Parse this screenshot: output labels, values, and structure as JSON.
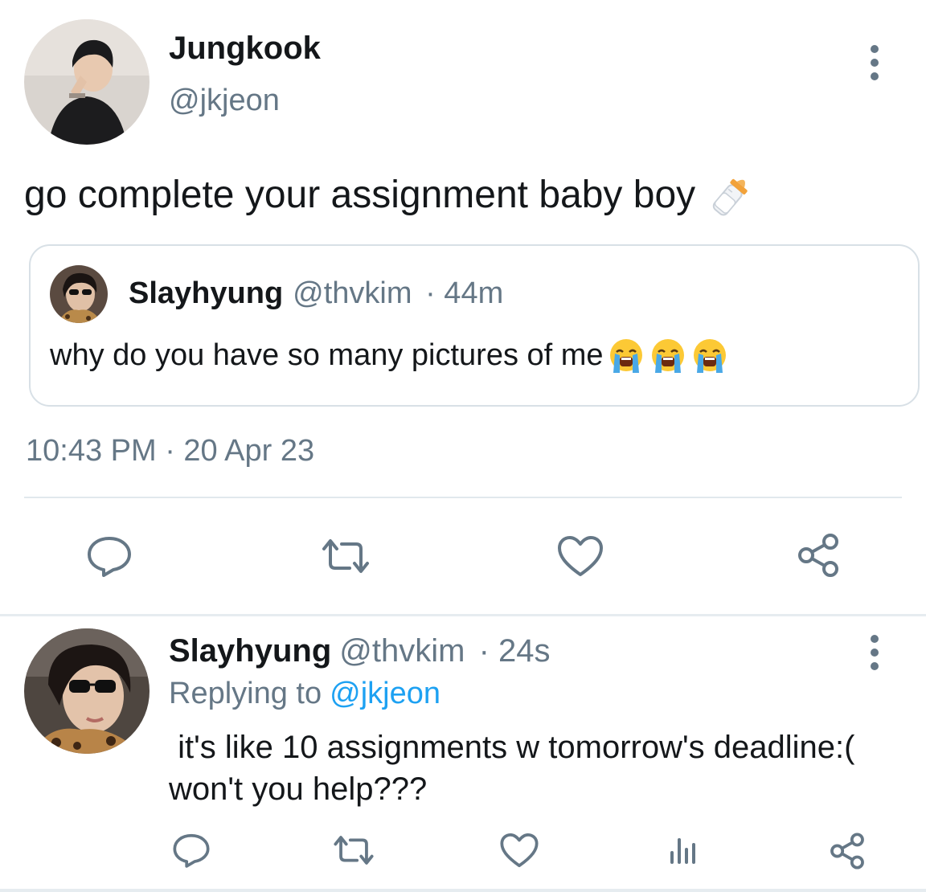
{
  "main_tweet": {
    "display_name": "Jungkook",
    "handle": "@jkjeon",
    "text": "go complete your assignment baby boy",
    "emoji": "baby-bottle-icon",
    "timestamp": "10:43 PM · 20 Apr 23"
  },
  "quoted_tweet": {
    "display_name": "Slayhyung",
    "handle": "@thvkim",
    "time": "· 44m",
    "text": "why do you have so many pictures of me",
    "emoji": [
      "crying-face-icon",
      "crying-face-icon",
      "crying-face-icon"
    ]
  },
  "reply_tweet": {
    "display_name": "Slayhyung",
    "handle": "@thvkim",
    "time": "· 24s",
    "replying_prefix": "Replying to",
    "replying_to": "@jkjeon",
    "text_line1": " it's like 10 assignments w tomorrow's deadline:(",
    "text_line2": "won't you help???"
  },
  "actions": {
    "main": [
      "reply-icon",
      "retweet-icon",
      "like-icon",
      "share-icon"
    ],
    "reply": [
      "reply-icon",
      "retweet-icon",
      "like-icon",
      "analytics-icon",
      "share-icon"
    ]
  },
  "colors": {
    "text": "#14171a",
    "secondary": "#657786",
    "accent": "#1da1f2",
    "border": "#d8e0e6"
  }
}
